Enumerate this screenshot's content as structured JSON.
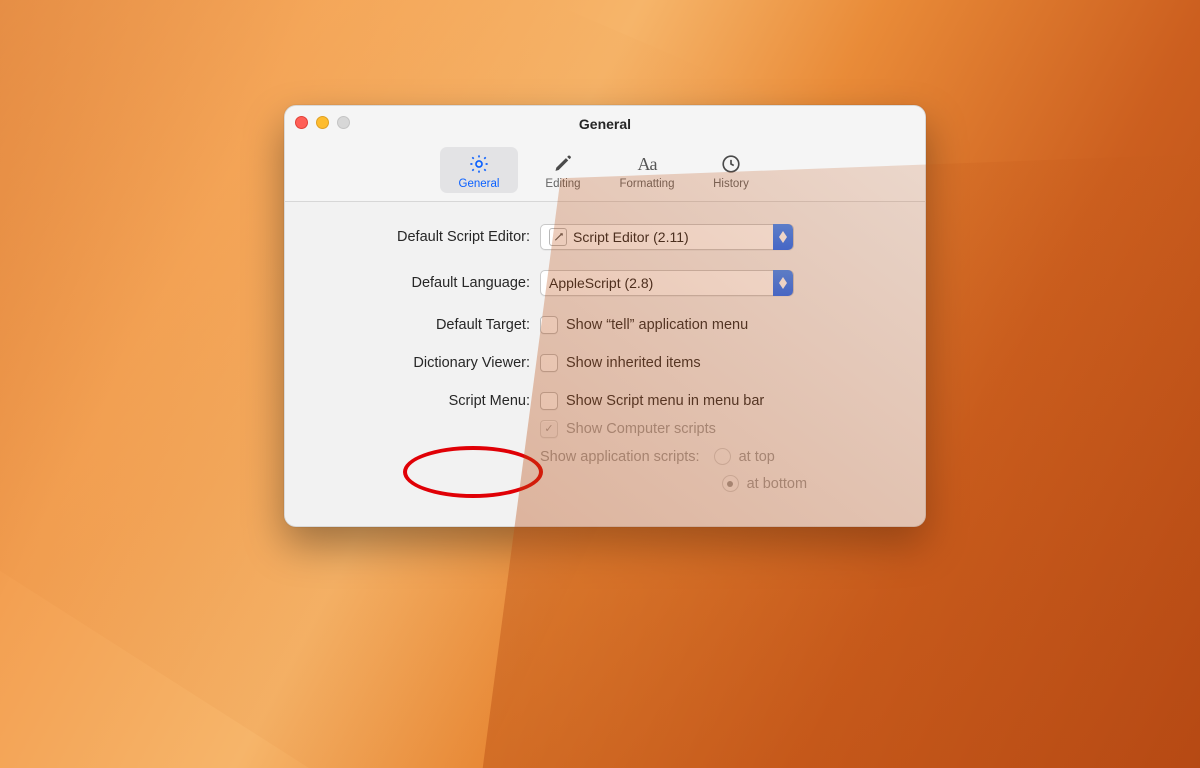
{
  "window": {
    "title": "General"
  },
  "toolbar": {
    "tabs": [
      {
        "id": "general",
        "label": "General"
      },
      {
        "id": "editing",
        "label": "Editing"
      },
      {
        "id": "formatting",
        "label": "Formatting"
      },
      {
        "id": "history",
        "label": "History"
      }
    ],
    "selected": "general"
  },
  "prefs": {
    "default_editor": {
      "label": "Default Script Editor:",
      "value": "Script Editor (2.11)"
    },
    "default_language": {
      "label": "Default Language:",
      "value": "AppleScript (2.8)"
    },
    "default_target": {
      "label": "Default Target:",
      "checkbox_label": "Show “tell” application menu",
      "checked": false
    },
    "dictionary_viewer": {
      "label": "Dictionary Viewer:",
      "checkbox_label": "Show inherited items",
      "checked": false
    },
    "script_menu": {
      "label": "Script Menu:",
      "show_in_menu_bar": {
        "label": "Show Script menu in menu bar",
        "checked": false
      },
      "show_computer_scripts": {
        "label": "Show Computer scripts",
        "checked": true,
        "enabled": false
      },
      "app_scripts": {
        "label": "Show application scripts:",
        "options": {
          "top": "at top",
          "bottom": "at bottom"
        },
        "selected": "bottom",
        "enabled": false
      }
    }
  }
}
